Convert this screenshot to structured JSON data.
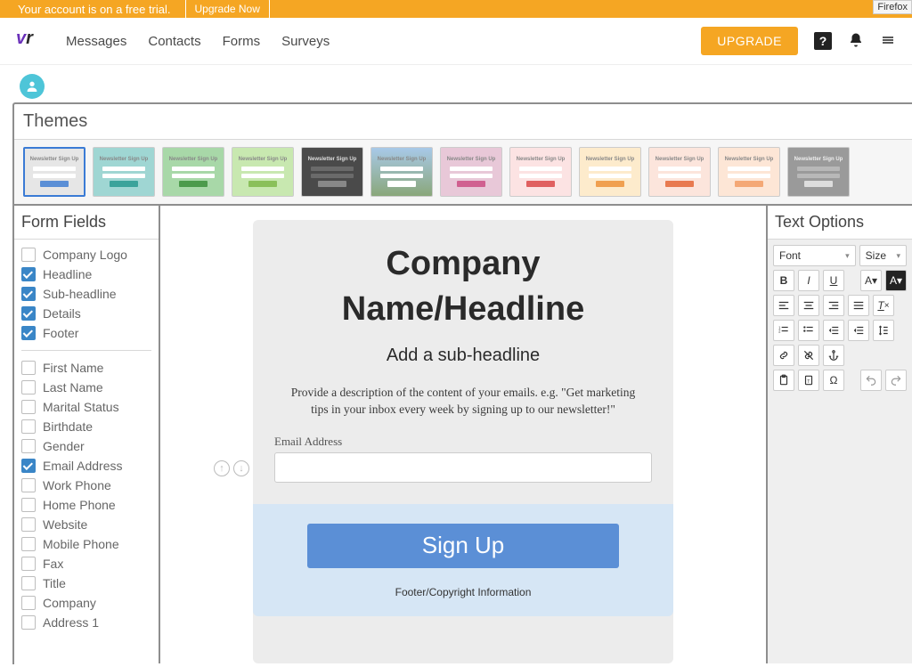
{
  "banner": {
    "text": "Your account is on a free trial.",
    "cta": "Upgrade Now"
  },
  "firefox_tag": "Firefox",
  "nav": {
    "links": [
      "Messages",
      "Contacts",
      "Forms",
      "Surveys"
    ],
    "upgrade": "UPGRADE"
  },
  "themes": {
    "title": "Themes",
    "thumb_title": "Newsletter Sign Up"
  },
  "form_fields": {
    "title": "Form Fields",
    "group1": [
      {
        "label": "Company Logo",
        "checked": false
      },
      {
        "label": "Headline",
        "checked": true
      },
      {
        "label": "Sub-headline",
        "checked": true
      },
      {
        "label": "Details",
        "checked": true
      },
      {
        "label": "Footer",
        "checked": true
      }
    ],
    "group2": [
      {
        "label": "First Name",
        "checked": false
      },
      {
        "label": "Last Name",
        "checked": false
      },
      {
        "label": "Marital Status",
        "checked": false
      },
      {
        "label": "Birthdate",
        "checked": false
      },
      {
        "label": "Gender",
        "checked": false
      },
      {
        "label": "Email Address",
        "checked": true
      },
      {
        "label": "Work Phone",
        "checked": false
      },
      {
        "label": "Home Phone",
        "checked": false
      },
      {
        "label": "Website",
        "checked": false
      },
      {
        "label": "Mobile Phone",
        "checked": false
      },
      {
        "label": "Fax",
        "checked": false
      },
      {
        "label": "Title",
        "checked": false
      },
      {
        "label": "Company",
        "checked": false
      },
      {
        "label": "Address 1",
        "checked": false
      }
    ]
  },
  "preview": {
    "headline": "Company Name/Headline",
    "subheadline": "Add a sub-headline",
    "details": "Provide a description of the content of your emails. e.g. \"Get marketing tips in your inbox every week by signing up to our newsletter!\"",
    "email_label": "Email Address",
    "button": "Sign Up",
    "footer": "Footer/Copyright Information"
  },
  "text_options": {
    "title": "Text Options",
    "font": "Font",
    "size": "Size"
  },
  "colors": {
    "accent": "#f5a623",
    "primary": "#5b8fd6"
  }
}
